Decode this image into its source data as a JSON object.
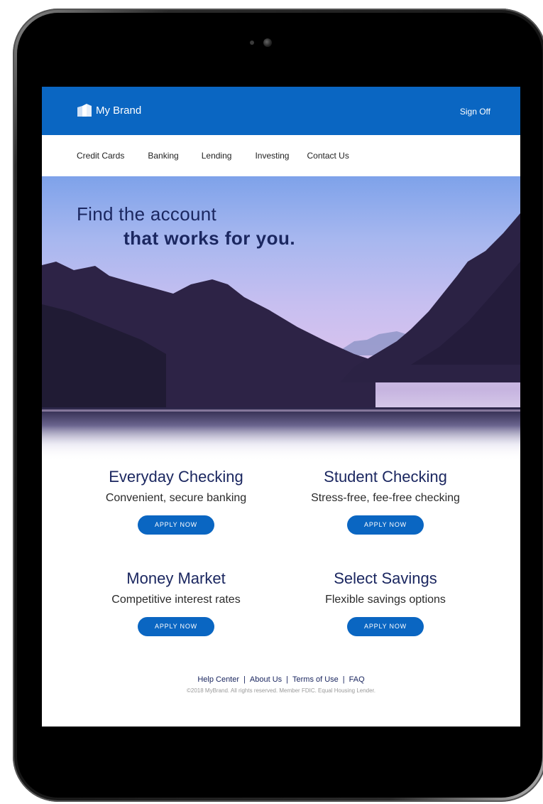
{
  "header": {
    "brand_name": "My Brand",
    "sign_off": "Sign Off"
  },
  "nav": {
    "items": [
      "Credit Cards",
      "Banking",
      "Lending",
      "Investing",
      "Contact Us"
    ]
  },
  "hero": {
    "line1": "Find the account",
    "line2": "that works for you."
  },
  "products": [
    {
      "title": "Everyday Checking",
      "subtitle": "Convenient, secure banking",
      "cta": "APPLY NOW"
    },
    {
      "title": "Student Checking",
      "subtitle": "Stress-free, fee-free checking",
      "cta": "APPLY NOW"
    },
    {
      "title": "Money Market",
      "subtitle": "Competitive interest rates",
      "cta": "APPLY NOW"
    },
    {
      "title": "Select Savings",
      "subtitle": "Flexible savings options",
      "cta": "APPLY NOW"
    }
  ],
  "footer": {
    "links": [
      "Help Center",
      "About Us",
      "Terms of Use",
      "FAQ"
    ],
    "separator": "|",
    "copyright": "©2018 MyBrand. All rights reserved. Member FDIC. Equal Housing Lender."
  },
  "colors": {
    "brand_blue": "#0a66c2",
    "heading_navy": "#1b2760"
  },
  "icons": {
    "brand_logo": "building-logo-icon"
  }
}
